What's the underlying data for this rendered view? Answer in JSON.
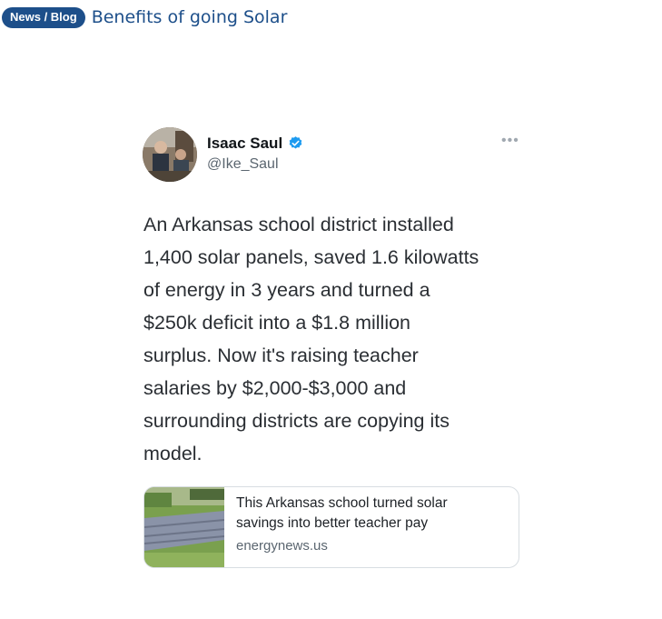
{
  "header": {
    "badge": "News / Blog",
    "title": "Benefits of going Solar"
  },
  "tweet": {
    "author_name": "Isaac Saul",
    "handle": "@Ike_Saul",
    "more_label": "•••",
    "lines": [
      "An Arkansas school district installed",
      "1,400 solar panels, saved 1.6 kilowatts",
      "of energy in 3 years and turned a",
      "$250k deficit into a $1.8 million",
      "surplus. Now it's raising teacher",
      "salaries by $2,000-$3,000 and",
      "surrounding districts are copying its",
      "model."
    ],
    "card": {
      "title_lines": [
        "This Arkansas school turned solar",
        "savings into better teacher pay"
      ],
      "domain": "energynews.us"
    }
  },
  "colors": {
    "brand": "#1d4f8a",
    "verified": "#1d9bf0"
  },
  "icons": [
    "verified-badge-icon",
    "more-options-icon"
  ]
}
